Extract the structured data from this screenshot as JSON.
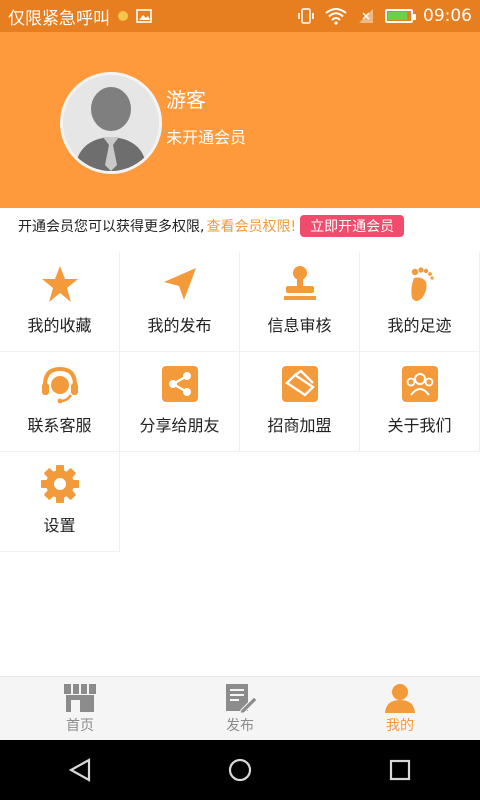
{
  "status_bar": {
    "carrier_text": "仅限紧急呼叫",
    "time": "09:06",
    "battery_level": 0.8
  },
  "profile": {
    "name": "游客",
    "membership": "未开通会员"
  },
  "member_strip": {
    "text": "开通会员您可以获得更多权限,",
    "link": "查看会员权限!",
    "button": "立即开通会员"
  },
  "grid": {
    "items": [
      {
        "label": "我的收藏",
        "icon": "star-icon"
      },
      {
        "label": "我的发布",
        "icon": "send-icon"
      },
      {
        "label": "信息审核",
        "icon": "stamp-icon"
      },
      {
        "label": "我的足迹",
        "icon": "footprint-icon"
      },
      {
        "label": "联系客服",
        "icon": "headset-icon"
      },
      {
        "label": "分享给朋友",
        "icon": "share-icon"
      },
      {
        "label": "招商加盟",
        "icon": "handshake-icon"
      },
      {
        "label": "关于我们",
        "icon": "group-icon"
      },
      {
        "label": "设置",
        "icon": "gear-icon"
      }
    ]
  },
  "bottom_nav": {
    "items": [
      {
        "label": "首页",
        "icon": "store-icon",
        "active": false
      },
      {
        "label": "发布",
        "icon": "edit-document-icon",
        "active": false
      },
      {
        "label": "我的",
        "icon": "user-icon",
        "active": true
      }
    ]
  },
  "colors": {
    "accent": "#ff9a3c",
    "status_bar": "#e77e1f",
    "active_nav": "#f39a3b",
    "inactive_nav": "#8c8c8c",
    "member_button": "#f14b6e"
  }
}
